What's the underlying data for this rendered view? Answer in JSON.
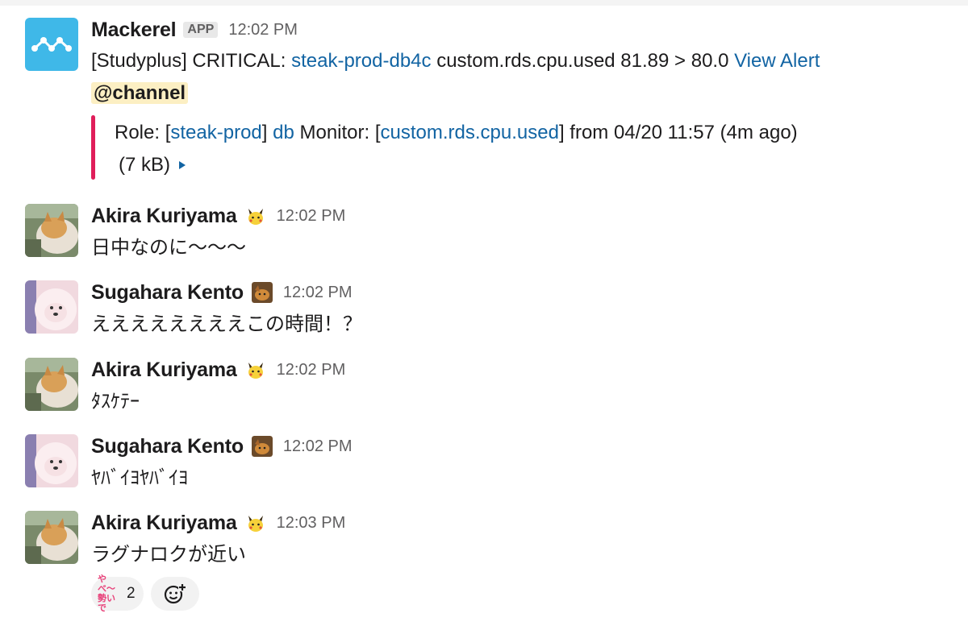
{
  "messages": [
    {
      "name": "Mackerel",
      "badge": "APP",
      "time": "12:02 PM",
      "text": {
        "prefix": "[Studyplus] CRITICAL: ",
        "host_link": "steak-prod-db4c",
        "middle": " custom.rds.cpu.used 81.89 > 80.0 ",
        "alert_link": "View Alert",
        "mention": "@channel"
      },
      "attachment": {
        "role_prefix": "Role: [",
        "role_link": "steak-prod",
        "role_close": "] ",
        "db_link": "db",
        "monitor_prefix": " Monitor: [",
        "monitor_link": "custom.rds.cpu.used",
        "monitor_suffix": "] from 04/20 11:57 (4m ago)",
        "size": "(7 kB)"
      }
    },
    {
      "name": "Akira Kuriyama",
      "time": "12:02 PM",
      "text": "日中なのに〜〜〜"
    },
    {
      "name": "Sugahara Kento",
      "time": "12:02 PM",
      "text": "ええええええええこの時間！？"
    },
    {
      "name": "Akira Kuriyama",
      "time": "12:02 PM",
      "text": "ﾀｽｹﾃｰ"
    },
    {
      "name": "Sugahara Kento",
      "time": "12:02 PM",
      "text": "ﾔﾊﾞｲﾖﾔﾊﾞｲﾖ"
    },
    {
      "name": "Akira Kuriyama",
      "time": "12:03 PM",
      "text": "ラグナロクが近い"
    }
  ],
  "reactions": [
    {
      "emoji_text_line1": "やべ〜",
      "emoji_text_line2": "勢いで",
      "count": "2"
    }
  ],
  "colors": {
    "link": "#1264a3",
    "attachment_bar": "#e01e5a",
    "mention_bg": "#fcefc3",
    "app_icon": "#3fb8e8"
  },
  "icons": {
    "app_avatar": "mackerel-logo-icon",
    "akira_status": "pikachu-emoji-icon",
    "kento_status": "dog-emoji-icon",
    "expand": "caret-right-icon",
    "add_reaction": "add-emoji-icon"
  }
}
